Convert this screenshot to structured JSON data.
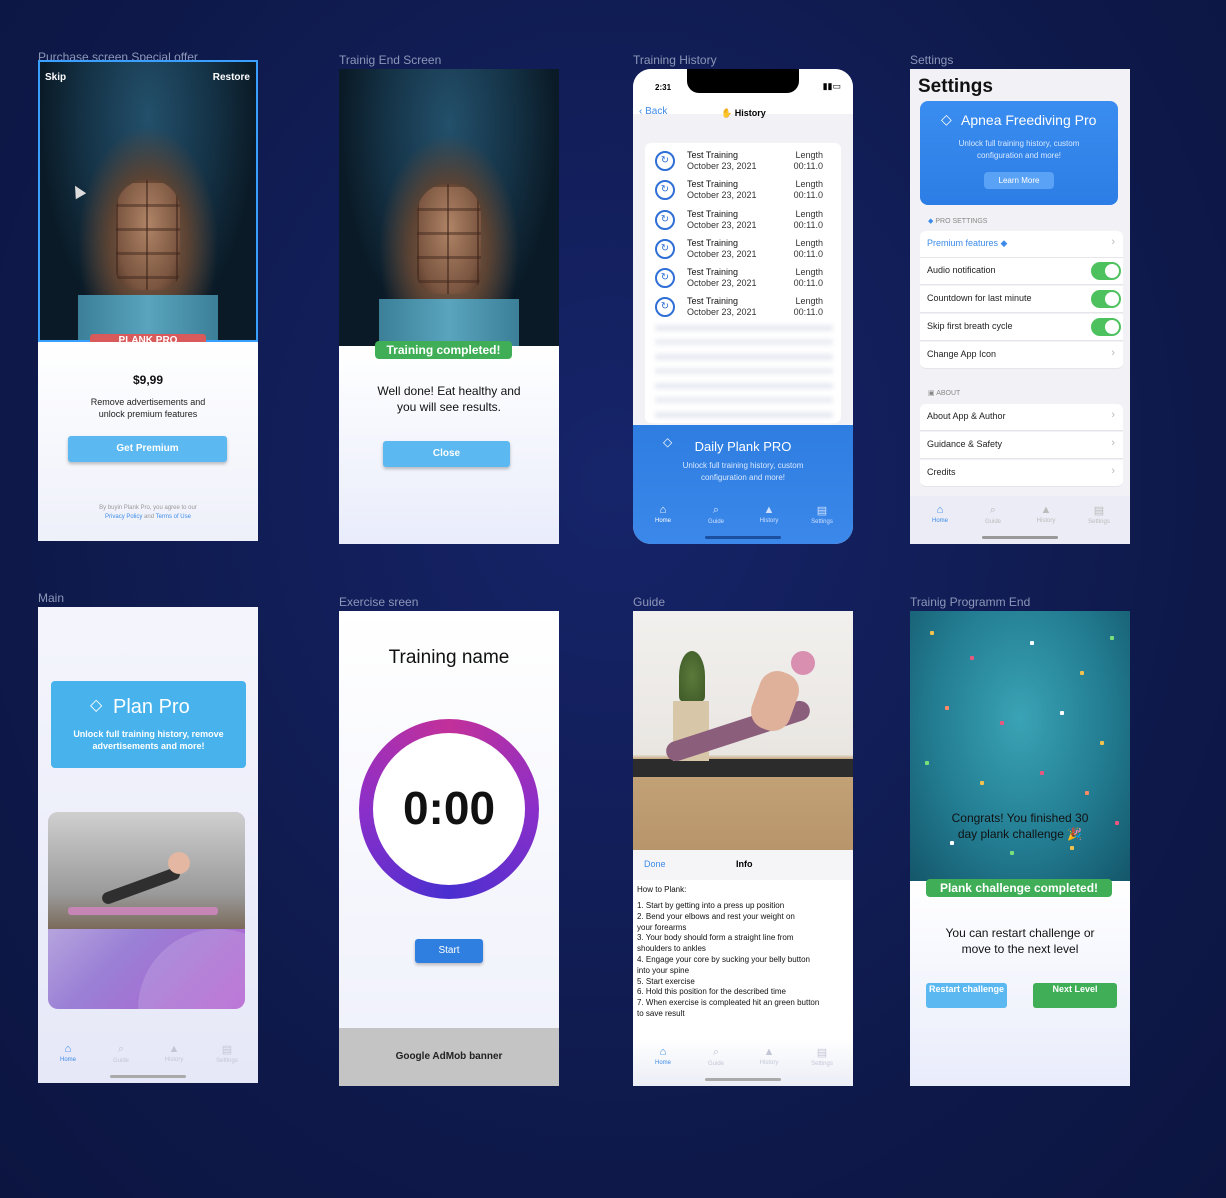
{
  "frames": {
    "purchase": {
      "label": "Purchase screen Special offer",
      "skip": "Skip",
      "restore": "Restore",
      "badge": "PLANK PRO",
      "price": "$9,99",
      "desc_line1": "Remove advertisements and",
      "desc_line2": "unlock premium features",
      "cta": "Get Premium",
      "legal_line1": "By buyin Plank Pro, you agree to our",
      "privacy": "Privacy Policy",
      "and": "and",
      "terms": "Terms of Use"
    },
    "training_end": {
      "label": "Trainig End Screen",
      "badge": "Training completed!",
      "message_line1": "Well done! Eat healthy and",
      "message_line2": "you will see results.",
      "close": "Close"
    },
    "history": {
      "label": "Training History",
      "time": "2:31",
      "back": "Back",
      "title": "History",
      "rows": [
        {
          "title": "Test Training",
          "date": "October 23, 2021",
          "len_label": "Length",
          "len": "00:11.0"
        },
        {
          "title": "Test Training",
          "date": "October 23, 2021",
          "len_label": "Length",
          "len": "00:11.0"
        },
        {
          "title": "Test Training",
          "date": "October 23, 2021",
          "len_label": "Length",
          "len": "00:11.0"
        },
        {
          "title": "Test Training",
          "date": "October 23, 2021",
          "len_label": "Length",
          "len": "00:11.0"
        },
        {
          "title": "Test Training",
          "date": "October 23, 2021",
          "len_label": "Length",
          "len": "00:11.0"
        },
        {
          "title": "Test Training",
          "date": "October 23, 2021",
          "len_label": "Length",
          "len": "00:11.0"
        }
      ],
      "promo_title": "Daily Plank PRO",
      "promo_line1": "Unlock full training history, custom",
      "promo_line2": "configuration and more!",
      "tabs": [
        "Home",
        "Guide",
        "History",
        "Settings"
      ]
    },
    "settings": {
      "label": "Settings",
      "title": "Settings",
      "promo_title": "Apnea Freediving Pro",
      "promo_line1": "Unlock full training history, custom",
      "promo_line2": "configuration and more!",
      "learn_more": "Learn More",
      "pro_header": "PRO SETTINGS",
      "premium_features": "Premium features",
      "audio": "Audio notification",
      "countdown": "Countdown for last minute",
      "skip_breath": "Skip first breath cycle",
      "change_icon": "Change App Icon",
      "about_header": "ABOUT",
      "about_app": "About App & Author",
      "guidance": "Guidance & Safety",
      "credits": "Credits",
      "tabs": [
        "Home",
        "Guide",
        "History",
        "Settings"
      ]
    },
    "main": {
      "label": "Main",
      "promo_title": "Plan Pro",
      "promo_line1": "Unlock full training history, remove",
      "promo_line2": "advertisements and more!",
      "tabs": [
        "Home",
        "Guide",
        "History",
        "Settings"
      ]
    },
    "exercise": {
      "label": "Exercise sreen",
      "title": "Training name",
      "timer": "0:00",
      "start": "Start",
      "banner": "Google AdMob banner"
    },
    "guide": {
      "label": "Guide",
      "done": "Done",
      "info": "Info",
      "heading": "How to Plank:",
      "steps": [
        "1. Start by getting into a press up position",
        "2. Bend your elbows and rest your weight on",
        "your forearms",
        "3. Your body should form a straight line from",
        "shoulders to ankles",
        "4. Engage your core by sucking your belly button",
        "into your spine",
        "5. Start exercise",
        "6. Hold this position for the described time",
        "7. When exercise is compleated hit an green button",
        "to save result"
      ],
      "tabs": [
        "Home",
        "Guide",
        "History",
        "Settings"
      ]
    },
    "program_end": {
      "label": "Trainig Programm End",
      "congrats_line1": "Congrats! You finished 30",
      "congrats_line2": "day plank challenge 🎉",
      "badge": "Plank challenge completed!",
      "message_line1": "You can restart challenge or",
      "message_line2": "move to the next level",
      "restart": "Restart challenge",
      "next": "Next Level"
    }
  },
  "colors": {
    "background": "#0f1a4a",
    "accent_blue": "#3d8be8",
    "button_blue": "#5bb8f0",
    "green": "#3fae56",
    "timer_ring_start": "#c2309a",
    "timer_ring_end": "#4a2fd0"
  }
}
